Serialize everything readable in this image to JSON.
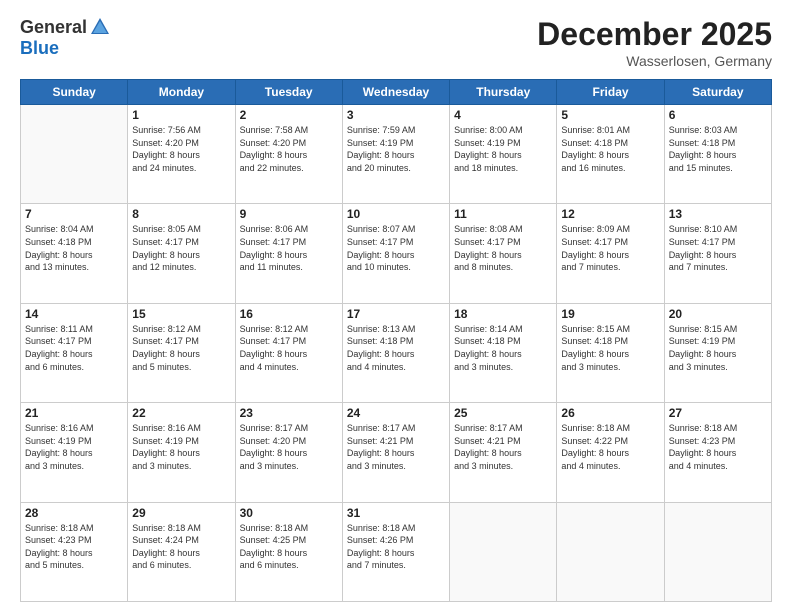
{
  "header": {
    "logo_general": "General",
    "logo_blue": "Blue",
    "month_title": "December 2025",
    "location": "Wasserlosen, Germany"
  },
  "days_of_week": [
    "Sunday",
    "Monday",
    "Tuesday",
    "Wednesday",
    "Thursday",
    "Friday",
    "Saturday"
  ],
  "weeks": [
    [
      {
        "day": "",
        "info": ""
      },
      {
        "day": "1",
        "info": "Sunrise: 7:56 AM\nSunset: 4:20 PM\nDaylight: 8 hours\nand 24 minutes."
      },
      {
        "day": "2",
        "info": "Sunrise: 7:58 AM\nSunset: 4:20 PM\nDaylight: 8 hours\nand 22 minutes."
      },
      {
        "day": "3",
        "info": "Sunrise: 7:59 AM\nSunset: 4:19 PM\nDaylight: 8 hours\nand 20 minutes."
      },
      {
        "day": "4",
        "info": "Sunrise: 8:00 AM\nSunset: 4:19 PM\nDaylight: 8 hours\nand 18 minutes."
      },
      {
        "day": "5",
        "info": "Sunrise: 8:01 AM\nSunset: 4:18 PM\nDaylight: 8 hours\nand 16 minutes."
      },
      {
        "day": "6",
        "info": "Sunrise: 8:03 AM\nSunset: 4:18 PM\nDaylight: 8 hours\nand 15 minutes."
      }
    ],
    [
      {
        "day": "7",
        "info": "Sunrise: 8:04 AM\nSunset: 4:18 PM\nDaylight: 8 hours\nand 13 minutes."
      },
      {
        "day": "8",
        "info": "Sunrise: 8:05 AM\nSunset: 4:17 PM\nDaylight: 8 hours\nand 12 minutes."
      },
      {
        "day": "9",
        "info": "Sunrise: 8:06 AM\nSunset: 4:17 PM\nDaylight: 8 hours\nand 11 minutes."
      },
      {
        "day": "10",
        "info": "Sunrise: 8:07 AM\nSunset: 4:17 PM\nDaylight: 8 hours\nand 10 minutes."
      },
      {
        "day": "11",
        "info": "Sunrise: 8:08 AM\nSunset: 4:17 PM\nDaylight: 8 hours\nand 8 minutes."
      },
      {
        "day": "12",
        "info": "Sunrise: 8:09 AM\nSunset: 4:17 PM\nDaylight: 8 hours\nand 7 minutes."
      },
      {
        "day": "13",
        "info": "Sunrise: 8:10 AM\nSunset: 4:17 PM\nDaylight: 8 hours\nand 7 minutes."
      }
    ],
    [
      {
        "day": "14",
        "info": "Sunrise: 8:11 AM\nSunset: 4:17 PM\nDaylight: 8 hours\nand 6 minutes."
      },
      {
        "day": "15",
        "info": "Sunrise: 8:12 AM\nSunset: 4:17 PM\nDaylight: 8 hours\nand 5 minutes."
      },
      {
        "day": "16",
        "info": "Sunrise: 8:12 AM\nSunset: 4:17 PM\nDaylight: 8 hours\nand 4 minutes."
      },
      {
        "day": "17",
        "info": "Sunrise: 8:13 AM\nSunset: 4:18 PM\nDaylight: 8 hours\nand 4 minutes."
      },
      {
        "day": "18",
        "info": "Sunrise: 8:14 AM\nSunset: 4:18 PM\nDaylight: 8 hours\nand 3 minutes."
      },
      {
        "day": "19",
        "info": "Sunrise: 8:15 AM\nSunset: 4:18 PM\nDaylight: 8 hours\nand 3 minutes."
      },
      {
        "day": "20",
        "info": "Sunrise: 8:15 AM\nSunset: 4:19 PM\nDaylight: 8 hours\nand 3 minutes."
      }
    ],
    [
      {
        "day": "21",
        "info": "Sunrise: 8:16 AM\nSunset: 4:19 PM\nDaylight: 8 hours\nand 3 minutes."
      },
      {
        "day": "22",
        "info": "Sunrise: 8:16 AM\nSunset: 4:19 PM\nDaylight: 8 hours\nand 3 minutes."
      },
      {
        "day": "23",
        "info": "Sunrise: 8:17 AM\nSunset: 4:20 PM\nDaylight: 8 hours\nand 3 minutes."
      },
      {
        "day": "24",
        "info": "Sunrise: 8:17 AM\nSunset: 4:21 PM\nDaylight: 8 hours\nand 3 minutes."
      },
      {
        "day": "25",
        "info": "Sunrise: 8:17 AM\nSunset: 4:21 PM\nDaylight: 8 hours\nand 3 minutes."
      },
      {
        "day": "26",
        "info": "Sunrise: 8:18 AM\nSunset: 4:22 PM\nDaylight: 8 hours\nand 4 minutes."
      },
      {
        "day": "27",
        "info": "Sunrise: 8:18 AM\nSunset: 4:23 PM\nDaylight: 8 hours\nand 4 minutes."
      }
    ],
    [
      {
        "day": "28",
        "info": "Sunrise: 8:18 AM\nSunset: 4:23 PM\nDaylight: 8 hours\nand 5 minutes."
      },
      {
        "day": "29",
        "info": "Sunrise: 8:18 AM\nSunset: 4:24 PM\nDaylight: 8 hours\nand 6 minutes."
      },
      {
        "day": "30",
        "info": "Sunrise: 8:18 AM\nSunset: 4:25 PM\nDaylight: 8 hours\nand 6 minutes."
      },
      {
        "day": "31",
        "info": "Sunrise: 8:18 AM\nSunset: 4:26 PM\nDaylight: 8 hours\nand 7 minutes."
      },
      {
        "day": "",
        "info": ""
      },
      {
        "day": "",
        "info": ""
      },
      {
        "day": "",
        "info": ""
      }
    ]
  ]
}
